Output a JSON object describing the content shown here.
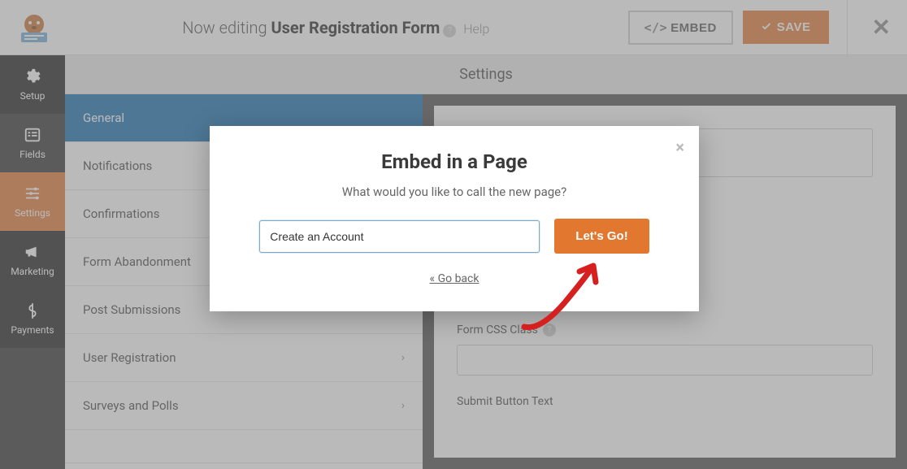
{
  "header": {
    "editing_prefix": "Now editing ",
    "form_name": "User Registration Form",
    "help_label": "Help",
    "embed_label": "EMBED",
    "save_label": "SAVE"
  },
  "leftnav": [
    {
      "label": "Setup"
    },
    {
      "label": "Fields"
    },
    {
      "label": "Settings"
    },
    {
      "label": "Marketing"
    },
    {
      "label": "Payments"
    }
  ],
  "settings": {
    "title": "Settings",
    "items": [
      {
        "label": "General",
        "expandable": false
      },
      {
        "label": "Notifications",
        "expandable": false
      },
      {
        "label": "Confirmations",
        "expandable": false
      },
      {
        "label": "Form Abandonment",
        "expandable": false
      },
      {
        "label": "Post Submissions",
        "expandable": false
      },
      {
        "label": "User Registration",
        "expandable": true
      },
      {
        "label": "Surveys and Polls",
        "expandable": true
      }
    ]
  },
  "content": {
    "css_label": "Form CSS Class",
    "submit_label": "Submit Button Text"
  },
  "modal": {
    "title": "Embed in a Page",
    "subtitle": "What would you like to call the new page?",
    "input_value": "Create an Account",
    "button_label": "Let's Go!",
    "back_label": "« Go back"
  },
  "colors": {
    "accent": "#e27730",
    "nav_active": "#0e6cad"
  }
}
